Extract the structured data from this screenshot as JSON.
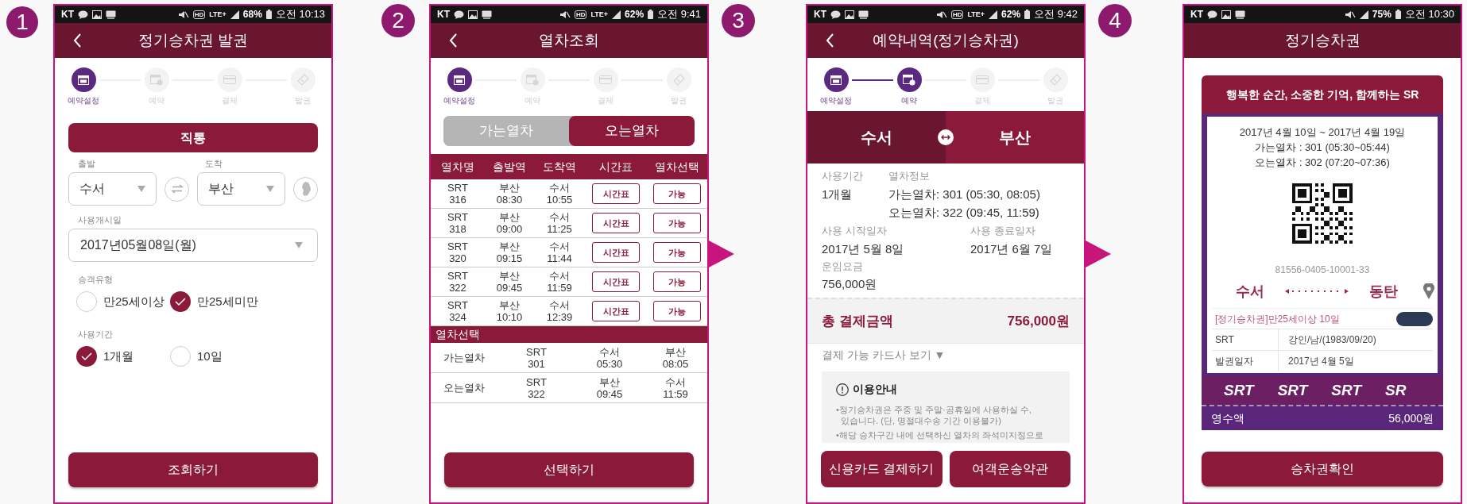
{
  "panels": [
    {
      "number": "1",
      "arrow_before": false,
      "kind": "pass_setup",
      "status": {
        "carrier": "KT",
        "hd": "HD",
        "network": "LTE+",
        "battery": "68%",
        "time": "오전 10:13"
      },
      "header": {
        "title": "정기승차권 발권",
        "back": true
      },
      "stepper": [
        {
          "label": "예약설정",
          "active": true
        },
        {
          "label": "예약",
          "active": false
        },
        {
          "label": "결제",
          "active": false
        },
        {
          "label": "발권",
          "active": false
        }
      ],
      "route_type": "직통",
      "from": {
        "label": "출발",
        "value": "수서"
      },
      "to": {
        "label": "도착",
        "value": "부산"
      },
      "start_date": {
        "label": "사용개시일",
        "value": "2017년05월08일(월)"
      },
      "passenger_type": {
        "label": "승객유형",
        "options": [
          {
            "label": "만25세이상",
            "selected": false
          },
          {
            "label": "만25세미만",
            "selected": true
          }
        ]
      },
      "period": {
        "label": "사용기간",
        "options": [
          {
            "label": "1개월",
            "selected": true
          },
          {
            "label": "10일",
            "selected": false
          }
        ]
      },
      "submit": "조회하기"
    },
    {
      "number": "2",
      "arrow_before": false,
      "kind": "train_search",
      "status": {
        "carrier": "KT",
        "hd": "HD",
        "network": "LTE+",
        "battery": "62%",
        "time": "오전 9:41"
      },
      "header": {
        "title": "열차조회",
        "back": true
      },
      "stepper": [
        {
          "label": "예약설정",
          "active": true
        },
        {
          "label": "예약",
          "active": false
        },
        {
          "label": "결제",
          "active": false
        },
        {
          "label": "발권",
          "active": false
        }
      ],
      "direction_tabs": [
        {
          "label": "가는열차",
          "selected": false
        },
        {
          "label": "오는열차",
          "selected": true
        }
      ],
      "table": {
        "columns": [
          "열차명",
          "출발역",
          "도착역",
          "시간표",
          "열차선택"
        ],
        "rows": [
          {
            "train": "SRT\n316",
            "departure": "부산\n08:30",
            "arrival": "수서\n10:55",
            "timetable": "시간표",
            "choice": "가능"
          },
          {
            "train": "SRT\n318",
            "departure": "부산\n09:00",
            "arrival": "수서\n11:25",
            "timetable": "시간표",
            "choice": "가능"
          },
          {
            "train": "SRT\n320",
            "departure": "부산\n09:15",
            "arrival": "수서\n11:44",
            "timetable": "시간표",
            "choice": "가능"
          },
          {
            "train": "SRT\n322",
            "departure": "부산\n09:45",
            "arrival": "수서\n11:59",
            "timetable": "시간표",
            "choice": "가능"
          },
          {
            "train": "SRT\n324",
            "departure": "부산\n10:10",
            "arrival": "수서\n12:39",
            "timetable": "시간표",
            "choice": "가능"
          }
        ]
      },
      "selection": {
        "title": "열차선택",
        "rows": [
          {
            "direction": "가는열차",
            "train": "SRT\n301",
            "departure": "수서\n05:30",
            "arrival": "부산\n08:05"
          },
          {
            "direction": "오는열차",
            "train": "SRT\n322",
            "departure": "부산\n09:45",
            "arrival": "수서\n11:59"
          }
        ]
      },
      "submit": "선택하기"
    },
    {
      "number": "3",
      "arrow_before": true,
      "kind": "reservation",
      "status": {
        "carrier": "KT",
        "hd": "HD",
        "network": "LTE+",
        "battery": "62%",
        "time": "오전 9:42"
      },
      "header": {
        "title": "예약내역(정기승차권)",
        "back": true
      },
      "stepper": [
        {
          "label": "예약설정",
          "active": true
        },
        {
          "label": "예약",
          "active": true
        },
        {
          "label": "결제",
          "active": false
        },
        {
          "label": "발권",
          "active": false
        }
      ],
      "route": {
        "from": "수서",
        "to": "부산"
      },
      "period": {
        "label": "사용기간",
        "value": "1개월"
      },
      "train_info": {
        "label": "열차정보",
        "lines": [
          "가는열차: 301 (05:30, 08:05)",
          "오는열차: 322 (09:45, 11:59)"
        ]
      },
      "start_date": {
        "label": "사용 시작일자",
        "value": "2017년 5월 8일"
      },
      "end_date": {
        "label": "사용 종료일자",
        "value": "2017년 6월 7일"
      },
      "fare": {
        "label": "운임요금",
        "value": "756,000원"
      },
      "total": {
        "label": "총 결제금액",
        "value": "756,000원"
      },
      "card_link": "결제 가능 카드사 보기 ▼",
      "notice": {
        "title": "이용안내",
        "items": [
          "•정기승차권은 주중 및 주말·공휴일에 사용하실 수,\n  있습니다. (단, 명절대수송 기간 이용불가)",
          "•해당 승차구간 내에 선택하신 열차의 좌석미지정으로"
        ]
      },
      "buttons": [
        "신용카드 결제하기",
        "여객운송약관"
      ]
    },
    {
      "number": "4",
      "arrow_before": true,
      "kind": "ticket",
      "status": {
        "carrier": "KT",
        "battery": "75%",
        "time": "오전 10:30"
      },
      "header": {
        "title": "정기승차권",
        "back": false
      },
      "ticket": {
        "slogan": "행복한 순간, 소중한 기억, 함께하는 SR",
        "lines": [
          "2017년 4월 10일 ~ 2017년 4월 19일",
          "가는열차 : 301 (05:30~05:44)",
          "오는열차 : 302 (07:20~07:36)"
        ],
        "code": "81556-0405-10001-33",
        "from": "수서",
        "to": "동탄",
        "ticket_type": "[정기승차권]만25세이상 10일",
        "rows": [
          {
            "label": "SRT",
            "value": "강인/남/(1983/09/20)"
          },
          {
            "label": "발권일자",
            "value": "2017년 4월 5일"
          }
        ],
        "brand": [
          "SRT",
          "SRT",
          "SRT",
          "SR"
        ],
        "receipt": {
          "label": "영수액",
          "value": "56,000원"
        }
      },
      "submit": "승차권확인"
    }
  ]
}
